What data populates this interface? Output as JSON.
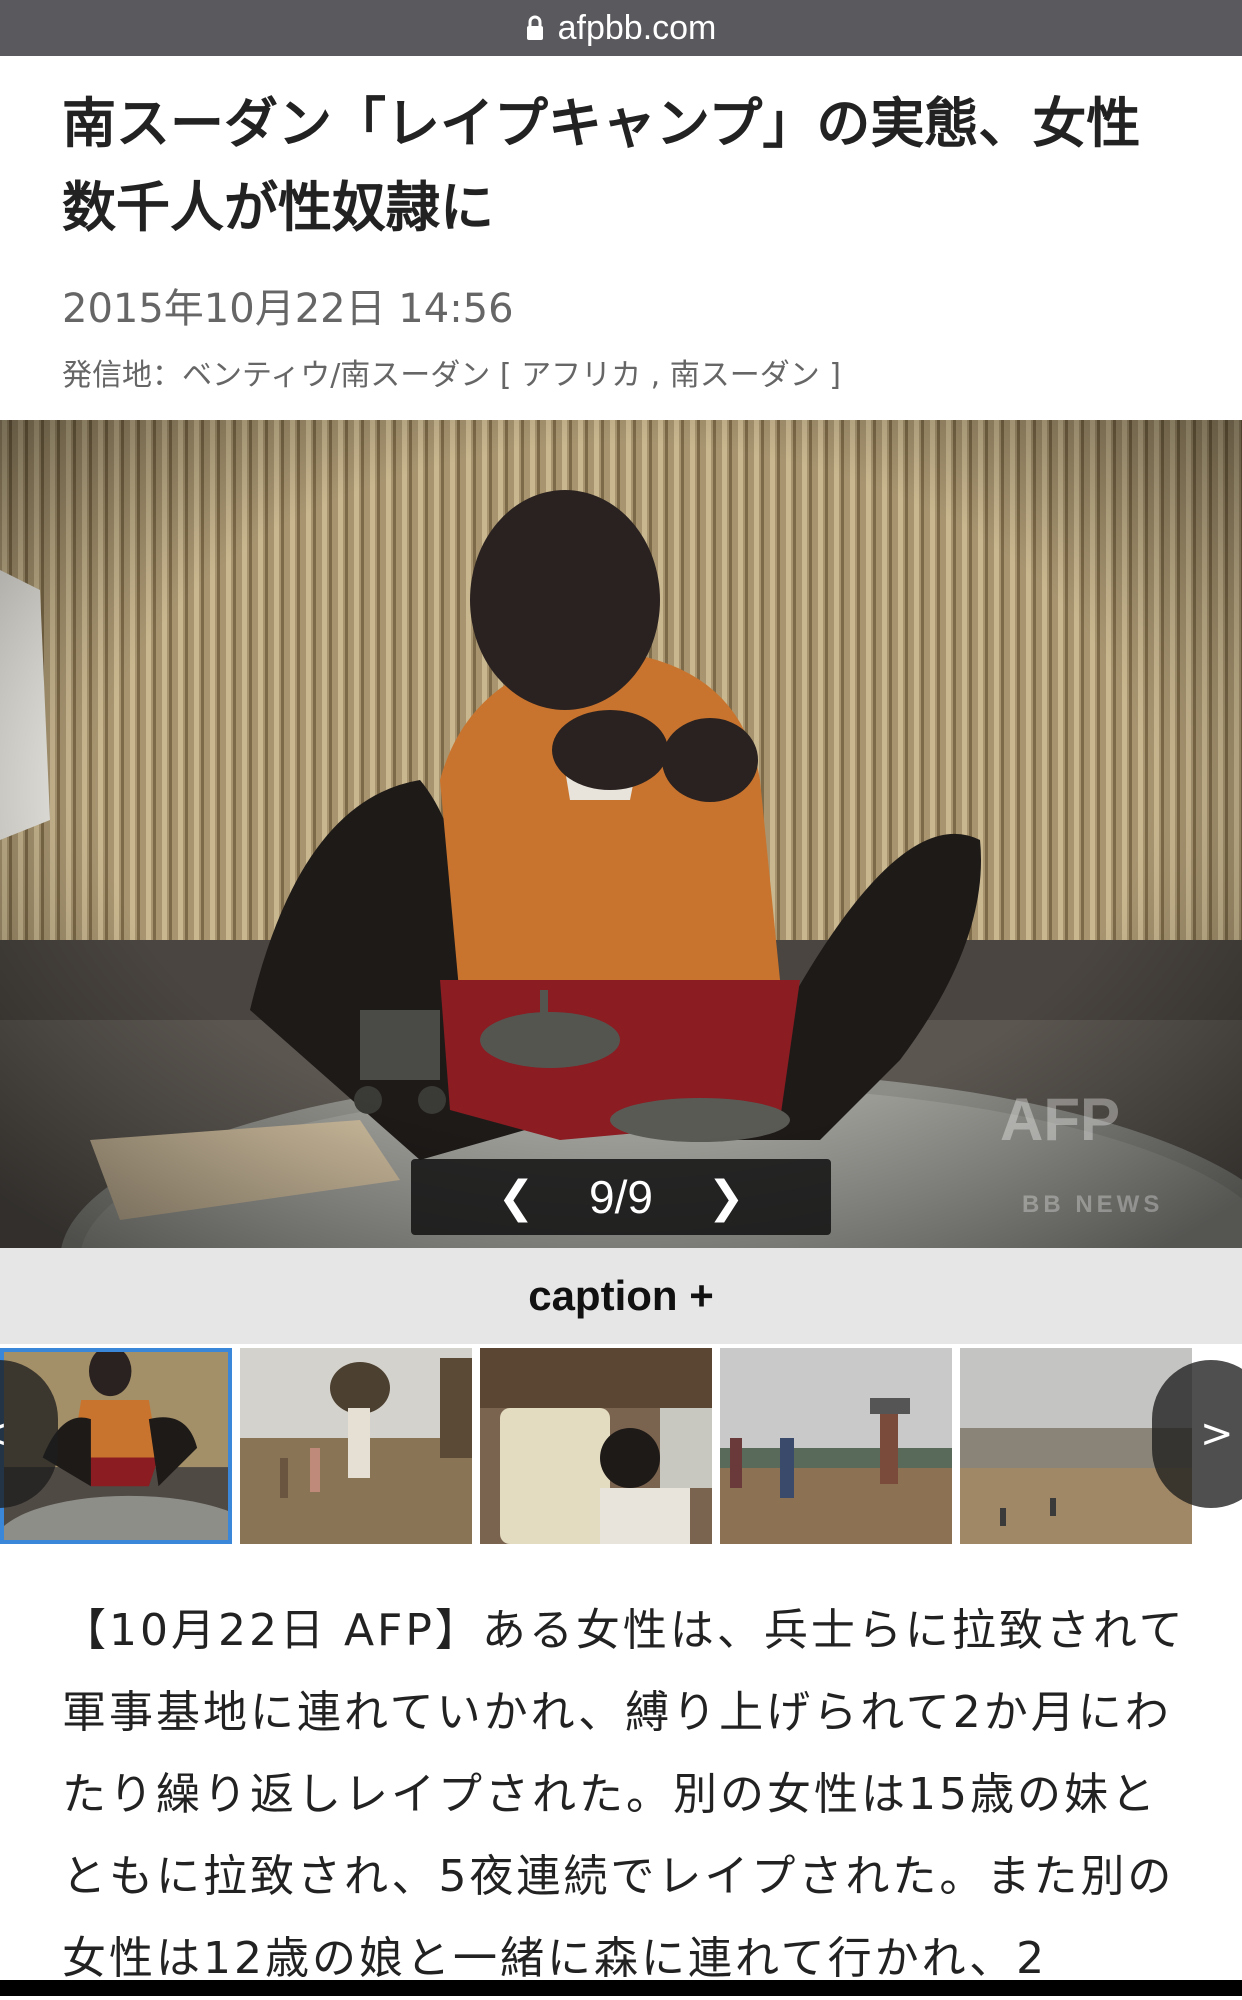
{
  "browser": {
    "url": "afpbb.com",
    "lock_icon": "lock-icon"
  },
  "article": {
    "title": "南スーダン「レイプキャンプ」の実態、女性数千人が性奴隷に",
    "date": "2015年10月22日 14:56",
    "origin": "発信地：ベンティウ/南スーダン [ アフリカ , 南スーダン ]",
    "body": "【10月22日 AFP】ある女性は、兵士らに拉致されて軍事基地に連れていかれ、縛り上げられて2か月にわたり繰り返しレイプされた。別の女性は15歳の妹とともに拉致され、5夜連続でレイプされた。また別の女性は12歳の娘と一緒に森に連れて行かれ、2"
  },
  "gallery": {
    "prev_label": "❮",
    "next_label": "❯",
    "counter": "9/9",
    "watermark": "AFP",
    "watermark_sub": "BB NEWS",
    "caption_label": "caption +",
    "thumb_prev_label": "<",
    "thumb_next_label": ">",
    "thumbnails": 5,
    "active_thumbnail": 1
  },
  "colors": {
    "accent": "#3a86d8",
    "url_bar": "#5a5a5e",
    "caption_bar": "#e6e6e6"
  }
}
